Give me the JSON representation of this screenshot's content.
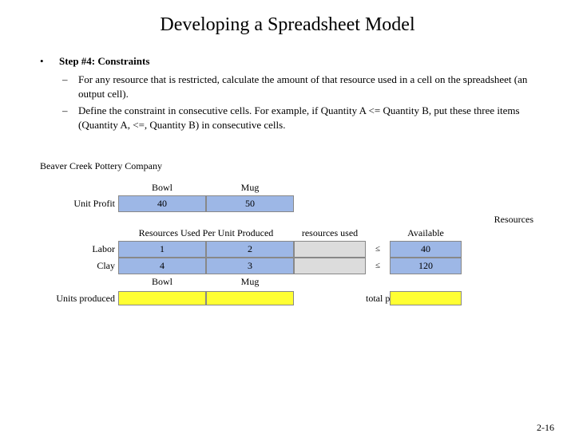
{
  "title": "Developing a Spreadsheet Model",
  "step_heading": "Step #4: Constraints",
  "sub_items": [
    "For any resource that is restricted, calculate the amount of that resource used in a cell on the spreadsheet (an output cell).",
    "Define the constraint in consecutive cells. For example, if Quantity A <= Quantity B, put these three items (Quantity A, <=, Quantity B) in consecutive cells."
  ],
  "company": "Beaver Creek Pottery Company",
  "sheet": {
    "cols": [
      "Bowl",
      "Mug"
    ],
    "unit_profit_label": "Unit Profit",
    "unit_profit": [
      "40",
      "50"
    ],
    "resources_label": "Resources",
    "section_title": "Resources Used Per Unit Produced",
    "resources_used_label": "resources used",
    "available_label": "Available",
    "rows": [
      {
        "name": "Labor",
        "vals": [
          "1",
          "2"
        ],
        "avail": "40"
      },
      {
        "name": "Clay",
        "vals": [
          "4",
          "3"
        ],
        "avail": "120"
      }
    ],
    "lower_cols": [
      "Bowl",
      "Mug"
    ],
    "units_produced_label": "Units produced",
    "total_profit_label": "total profit",
    "le_symbol": "≥"
  },
  "page_num": "2-16",
  "chart_data": {
    "type": "table",
    "title": "Beaver Creek Pottery Company",
    "columns": [
      "Bowl",
      "Mug"
    ],
    "unit_profit": {
      "Bowl": 40,
      "Mug": 50
    },
    "resources_used_per_unit": {
      "Labor": {
        "Bowl": 1,
        "Mug": 2
      },
      "Clay": {
        "Bowl": 4,
        "Mug": 3
      }
    },
    "resources_available": {
      "Labor": 40,
      "Clay": 120
    },
    "constraint_relation": "<=",
    "decision_cells": [
      "Units produced Bowl",
      "Units produced Mug"
    ],
    "objective_cell": "total profit"
  }
}
